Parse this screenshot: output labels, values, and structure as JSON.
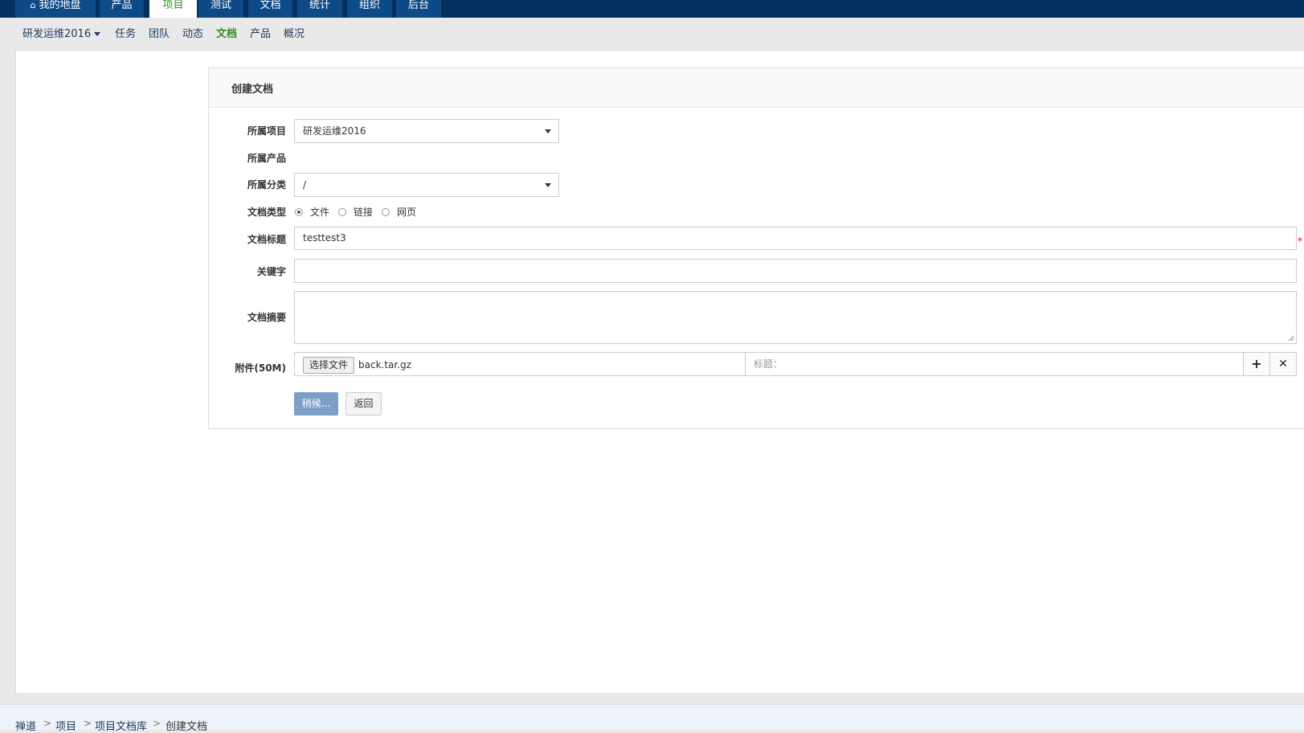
{
  "topnav": {
    "tabs": [
      {
        "label": "我的地盘",
        "icon": "home-icon"
      },
      {
        "label": "产品"
      },
      {
        "label": "项目",
        "active": true
      },
      {
        "label": "测试"
      },
      {
        "label": "文档"
      },
      {
        "label": "统计"
      },
      {
        "label": "组织"
      },
      {
        "label": "后台"
      }
    ]
  },
  "subnav": {
    "project": "研发运维2016",
    "items": [
      "任务",
      "团队",
      "动态",
      "文档",
      "产品",
      "概况"
    ],
    "active": "文档"
  },
  "form": {
    "title": "创建文档",
    "project_label": "所属项目",
    "project_value": "研发运维2016",
    "product_label": "所属产品",
    "category_label": "所属分类",
    "category_value": "/",
    "type_label": "文档类型",
    "type_options": [
      "文件",
      "链接",
      "网页"
    ],
    "type_selected": "文件",
    "title_label": "文档标题",
    "title_value": "testtest3",
    "required_mark": "*",
    "keywords_label": "关键字",
    "keywords_value": "",
    "summary_label": "文档摘要",
    "summary_value": "",
    "attachment_label": "附件(50M)",
    "choose_file_label": "选择文件",
    "file_name": "back.tar.gz",
    "file_title_placeholder": "标题：",
    "add_icon": "plus-icon",
    "remove_icon": "close-icon",
    "submit_label": "稍候...",
    "back_label": "返回"
  },
  "breadcrumb": [
    "禅道",
    "项目",
    "项目文档库",
    "创建文档"
  ],
  "colors": {
    "topnav_bg": "#03305f",
    "tab_bg": "#0d4a86",
    "active_green": "#2e8f1f",
    "submit_bg": "#7d9fc7",
    "required": "#ee0033"
  }
}
